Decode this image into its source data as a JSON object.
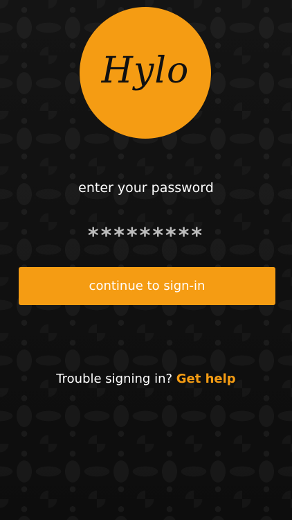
{
  "logo": {
    "text": "Hylo",
    "color": "#f59c13"
  },
  "signin": {
    "prompt": "enter your password",
    "password_value": "*********",
    "continue_label": "continue to sign-in"
  },
  "help": {
    "question": "Trouble signing in?",
    "link_label": "Get help"
  },
  "colors": {
    "accent": "#f59c13",
    "background": "#101010",
    "text": "#ffffff"
  }
}
